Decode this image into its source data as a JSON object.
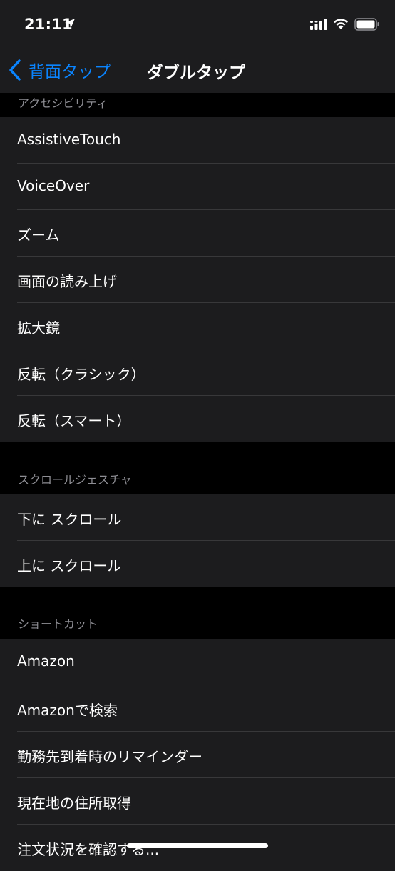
{
  "status_bar": {
    "time": "21:11"
  },
  "nav": {
    "back_label": "背面タップ",
    "title": "ダブルタップ"
  },
  "sections": [
    {
      "header": "アクセシビリティ",
      "items": [
        "AssistiveTouch",
        "VoiceOver",
        "ズーム",
        "画面の読み上げ",
        "拡大鏡",
        "反転（クラシック）",
        "反転（スマート）"
      ]
    },
    {
      "header": "スクロールジェスチャ",
      "items": [
        "下に スクロール",
        "上に スクロール"
      ]
    },
    {
      "header": "ショートカット",
      "items": [
        "Amazon",
        "Amazonで検索",
        "勤務先到着時のリマインダー",
        "現在地の住所取得",
        "注文状況を確認する..."
      ]
    }
  ],
  "colors": {
    "accent": "#0a84ff",
    "background": "#000000",
    "cell": "#1c1c1e",
    "separator": "#38383a",
    "section_header_text": "#8d8d93"
  }
}
